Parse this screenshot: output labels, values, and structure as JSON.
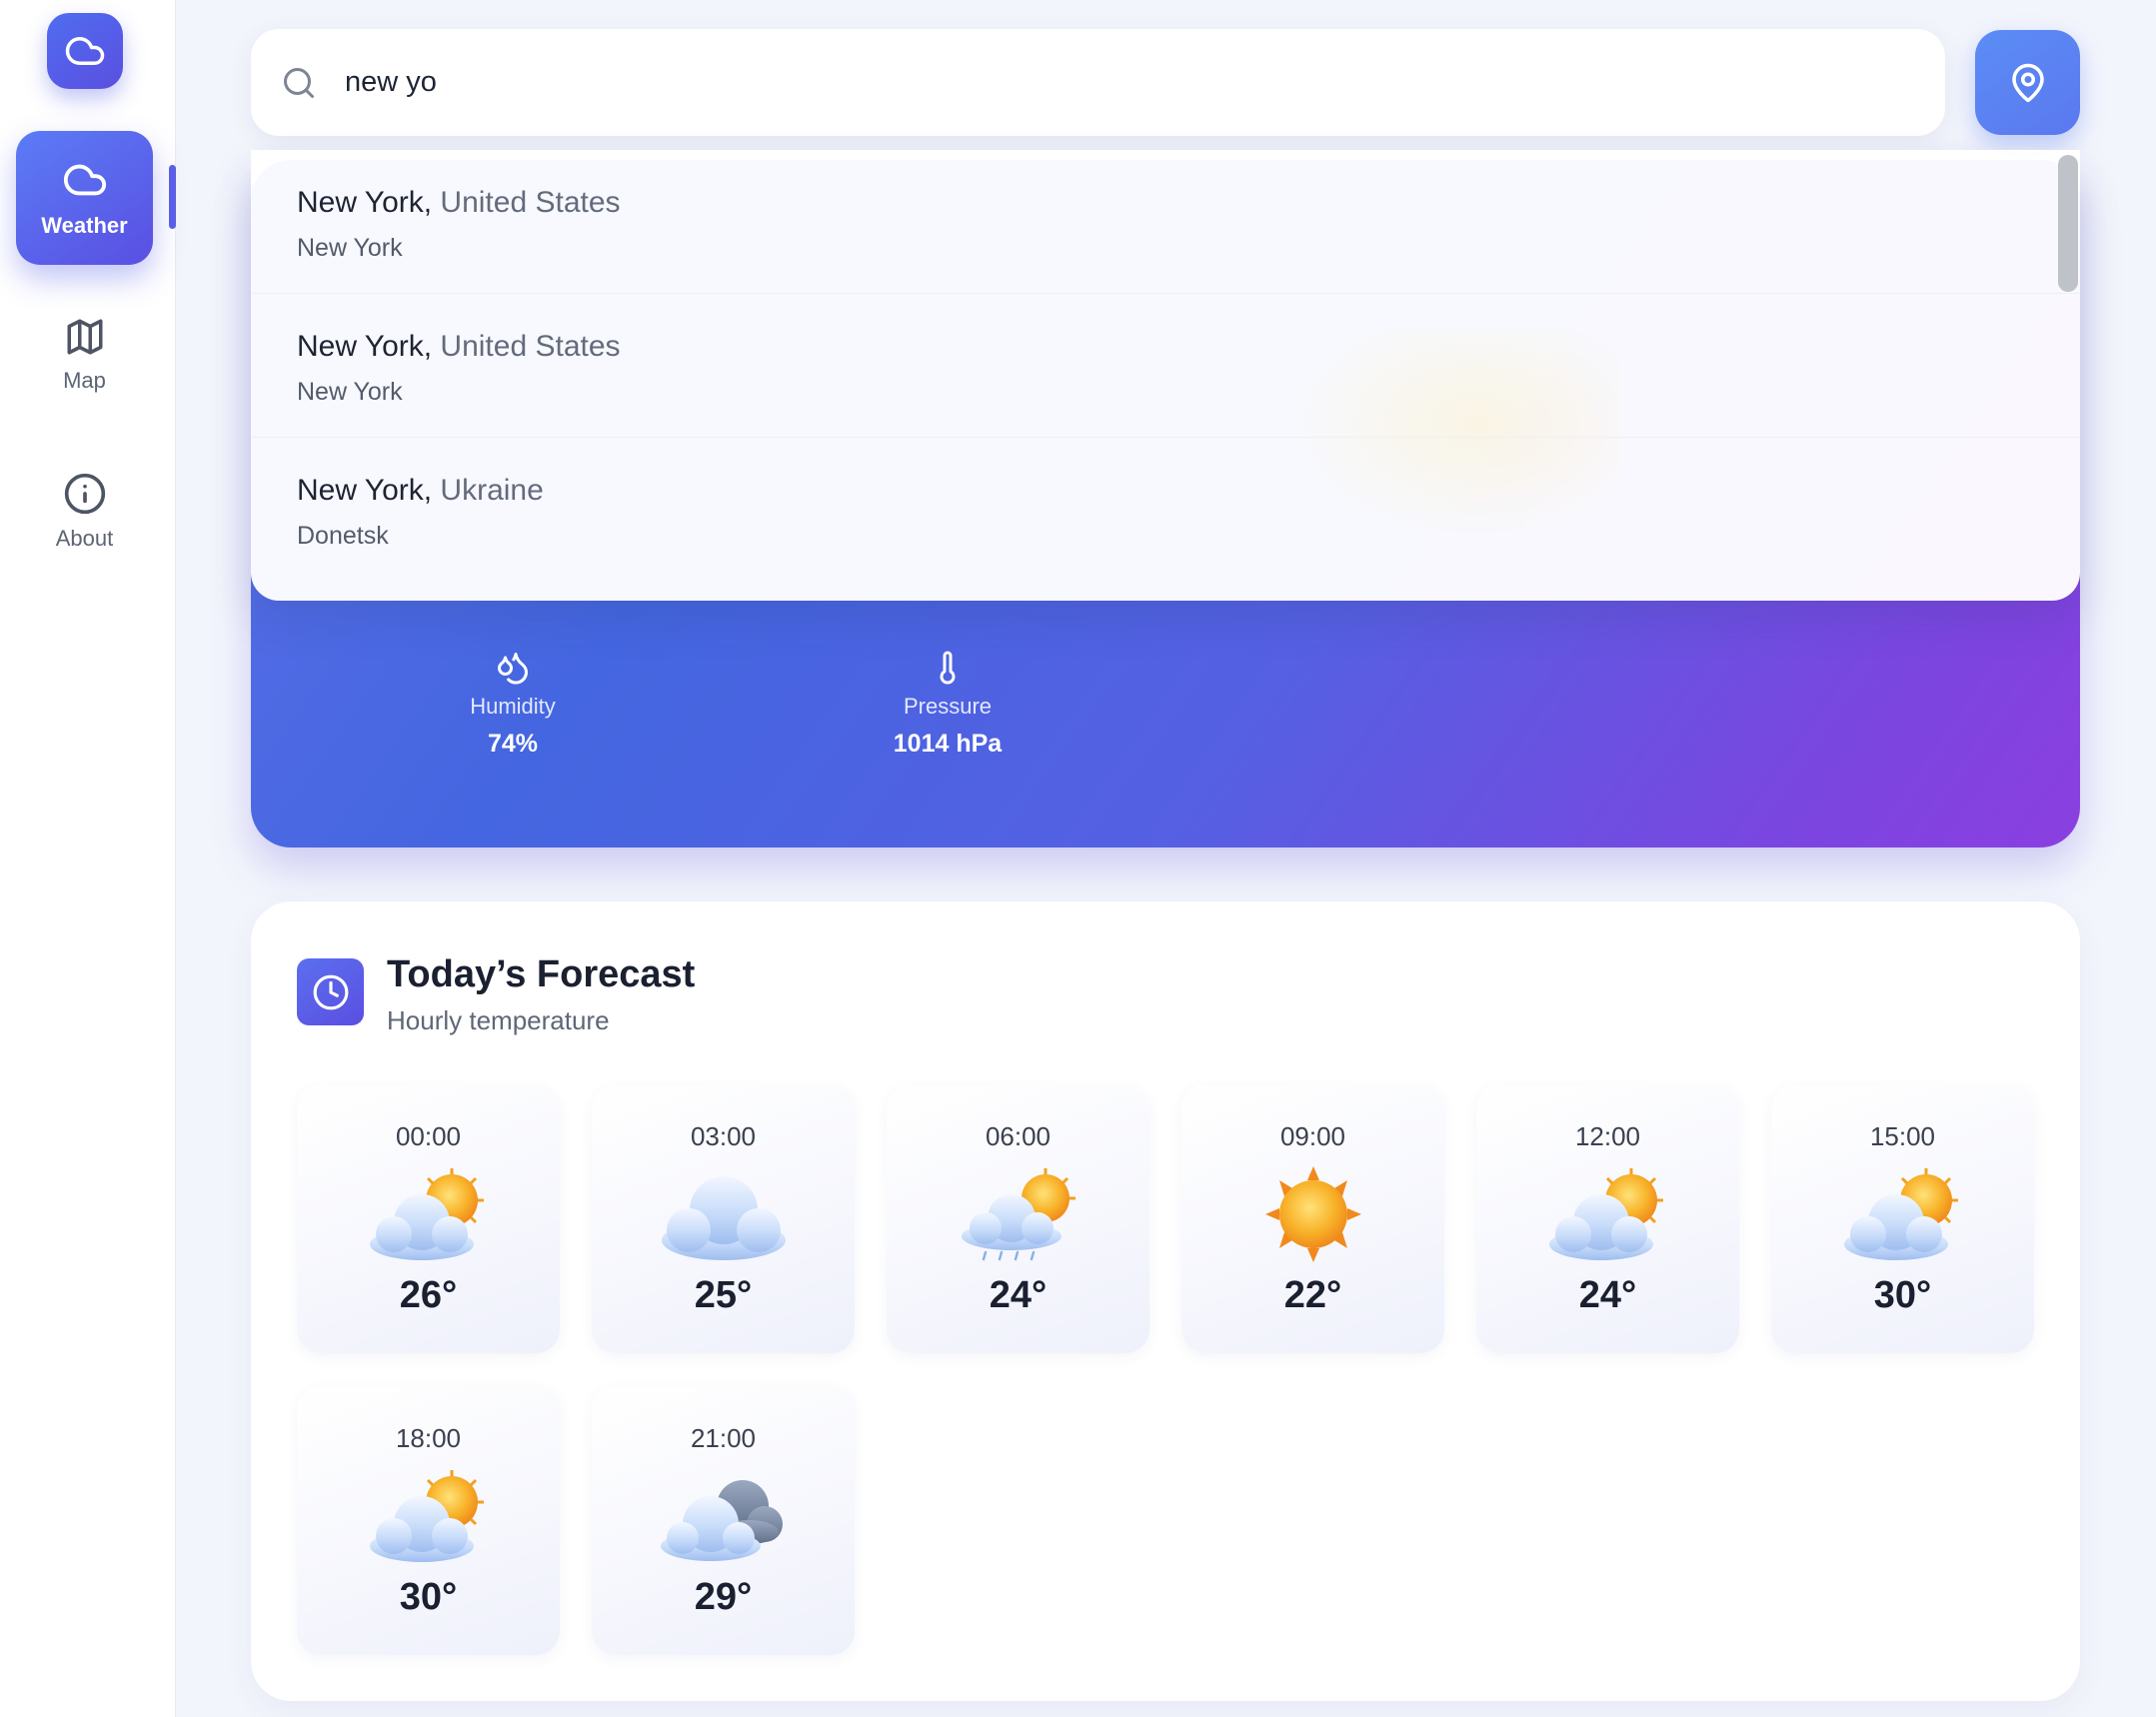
{
  "sidebar": {
    "logo_icon": "cloud-icon",
    "items": [
      {
        "label": "Weather",
        "icon": "cloud-icon",
        "active": true
      },
      {
        "label": "Map",
        "icon": "map-icon",
        "active": false
      },
      {
        "label": "About",
        "icon": "info-icon",
        "active": false
      }
    ]
  },
  "search": {
    "value": "new yo",
    "icon": "search-icon",
    "location_button_icon": "map-pin-icon"
  },
  "suggestions": [
    {
      "city": "New York,",
      "country": "United States",
      "region": "New York"
    },
    {
      "city": "New York,",
      "country": "United States",
      "region": "New York"
    },
    {
      "city": "New York,",
      "country": "Ukraine",
      "region": "Donetsk"
    }
  ],
  "current": {
    "humidity": {
      "label": "Humidity",
      "value": "74%",
      "icon": "droplets-icon"
    },
    "pressure": {
      "label": "Pressure",
      "value": "1014 hPa",
      "icon": "thermometer-icon"
    }
  },
  "forecast": {
    "title": "Today’s Forecast",
    "subtitle": "Hourly temperature",
    "icon": "clock-icon",
    "hours": [
      {
        "time": "00:00",
        "temp": "26°",
        "icon": "partly-sunny-icon"
      },
      {
        "time": "03:00",
        "temp": "25°",
        "icon": "cloud-icon"
      },
      {
        "time": "06:00",
        "temp": "24°",
        "icon": "sun-rain-icon"
      },
      {
        "time": "09:00",
        "temp": "22°",
        "icon": "sun-icon"
      },
      {
        "time": "12:00",
        "temp": "24°",
        "icon": "partly-sunny-icon"
      },
      {
        "time": "15:00",
        "temp": "30°",
        "icon": "partly-sunny-icon"
      },
      {
        "time": "18:00",
        "temp": "30°",
        "icon": "partly-sunny-icon"
      },
      {
        "time": "21:00",
        "temp": "29°",
        "icon": "dark-clouds-icon"
      }
    ]
  },
  "colors": {
    "accent": "#5a5fe6",
    "hero_start": "#5b6fe8",
    "hero_end": "#8b3fe0"
  }
}
